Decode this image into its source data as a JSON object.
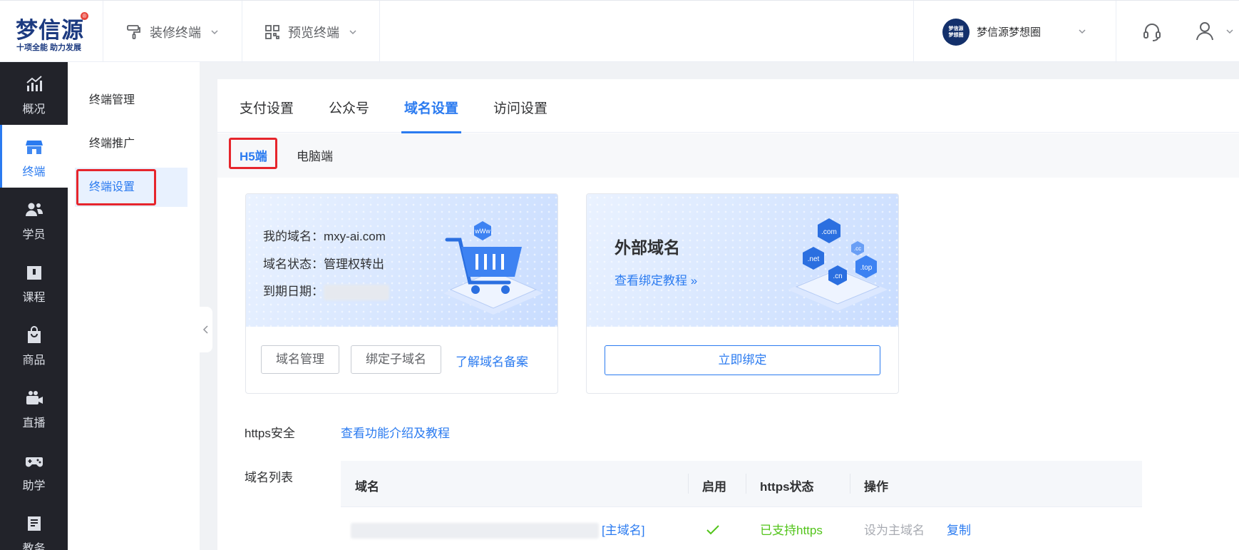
{
  "header": {
    "logo_text": "梦信源",
    "logo_reg": "®",
    "logo_slogan": "十项全能 助力发展",
    "menus": [
      {
        "label": "装修终端",
        "icon": "paint-roller-icon"
      },
      {
        "label": "预览终端",
        "icon": "qrcode-icon"
      }
    ],
    "org": {
      "avatar_line1": "梦信源",
      "avatar_line2": "梦想圈",
      "name": "梦信源梦想圈"
    },
    "support_icon": "headset-icon",
    "user_icon": "user-icon"
  },
  "rail": {
    "items": [
      {
        "label": "概况",
        "icon": "chart-trend-icon",
        "active": false
      },
      {
        "label": "终端",
        "icon": "store-icon",
        "active": true
      },
      {
        "label": "学员",
        "icon": "users-icon",
        "active": false
      },
      {
        "label": "课程",
        "icon": "book-icon",
        "active": false
      },
      {
        "label": "商品",
        "icon": "shopping-bag-icon",
        "active": false
      },
      {
        "label": "直播",
        "icon": "video-camera-icon",
        "active": false
      },
      {
        "label": "助学",
        "icon": "gamepad-icon",
        "active": false
      },
      {
        "label": "教务",
        "icon": "document-icon",
        "active": false
      }
    ]
  },
  "subnav": {
    "items": [
      {
        "label": "终端管理",
        "active": false
      },
      {
        "label": "终端推广",
        "active": false
      },
      {
        "label": "终端设置",
        "active": true
      }
    ]
  },
  "tabs": [
    {
      "label": "支付设置",
      "active": false
    },
    {
      "label": "公众号",
      "active": false
    },
    {
      "label": "域名设置",
      "active": true
    },
    {
      "label": "访问设置",
      "active": false
    }
  ],
  "subtabs": [
    {
      "label": "H5端",
      "active": true
    },
    {
      "label": "电脑端",
      "active": false
    }
  ],
  "my_domain_card": {
    "domain_label": "我的域名：",
    "domain_value": "mxy-ai.com",
    "status_label": "域名状态：",
    "status_value": "管理权转出",
    "expiry_label": "到期日期：",
    "illustration_badge": "wWw",
    "buttons": {
      "manage": "域名管理",
      "bind_sub": "绑定子域名",
      "learn_icp": "了解域名备案"
    }
  },
  "external_card": {
    "title": "外部域名",
    "tutorial_link": "查看绑定教程",
    "tutorial_arrow": "»",
    "tlds": [
      ".com",
      ".cc",
      ".net",
      ".top",
      ".cn"
    ],
    "bind_button": "立即绑定"
  },
  "https": {
    "label": "https安全",
    "link": "查看功能介绍及教程"
  },
  "domain_list": {
    "label": "域名列表",
    "columns": [
      "域名",
      "启用",
      "https状态",
      "操作"
    ],
    "rows": [
      {
        "domain_tag": "[主域名]",
        "enabled_icon": "check-icon",
        "https_status": "已支持https",
        "action_primary": "设为主域名",
        "action_copy": "复制"
      }
    ]
  },
  "colors": {
    "accent": "#2b7bf0",
    "rail_bg": "#22232a",
    "highlight": "#e6252c",
    "success": "#52c41a"
  }
}
